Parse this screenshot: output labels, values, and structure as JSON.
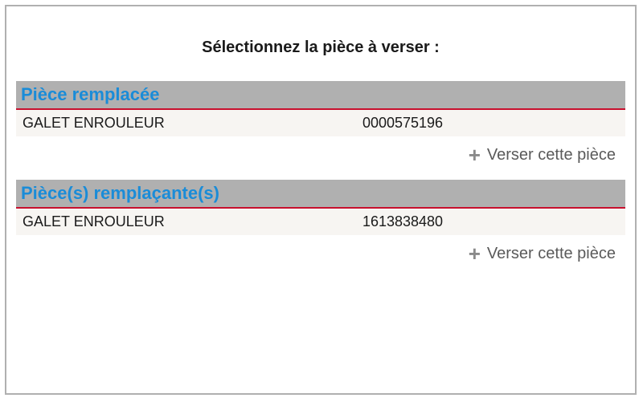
{
  "title": "Sélectionnez la pièce à verser :",
  "action_label": "Verser cette pièce",
  "sections": [
    {
      "header": "Pièce remplacée",
      "item": {
        "name": "GALET ENROULEUR",
        "ref": "0000575196"
      }
    },
    {
      "header": "Pièce(s) remplaçante(s)",
      "item": {
        "name": "GALET ENROULEUR",
        "ref": "1613838480"
      }
    }
  ]
}
